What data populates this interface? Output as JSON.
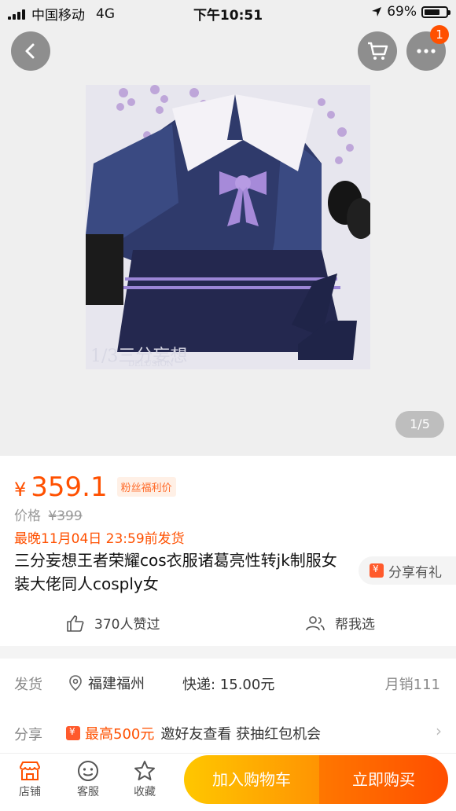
{
  "status_bar": {
    "carrier": "中国移动",
    "network": "4G",
    "time": "下午10:51",
    "battery": "69%"
  },
  "gallery": {
    "counter": "1/5",
    "cart_badge": "1",
    "watermark_main": "1/3三分妄想",
    "watermark_sub": "DELUSION"
  },
  "product": {
    "currency": "¥",
    "price": "359.1",
    "price_tag": "粉丝福利价",
    "orig_label": "价格",
    "orig_price": "¥399",
    "ship_notice": "最晚11月04日 23:59前发货",
    "title": "三分妄想王者荣耀cos衣服诸葛亮性转jk制服女装大佬同人cosply女",
    "share_label": "分享有礼",
    "likes": "370人赞过",
    "help_choose": "帮我选"
  },
  "delivery": {
    "label": "发货",
    "location": "福建福州",
    "fee": "快递: 15.00元",
    "monthly_sales": "月销111"
  },
  "share_row": {
    "label": "分享",
    "max_reward": "最高500元",
    "text": "邀好友查看 获抽红包机会"
  },
  "bottom": {
    "shop": "店铺",
    "service": "客服",
    "favorite": "收藏",
    "add_cart": "加入购物车",
    "buy_now": "立即购买"
  },
  "colors": {
    "accent": "#ff5000",
    "cart_gradient": [
      "#ffc700",
      "#ff9402"
    ],
    "buy_gradient": [
      "#ff7700",
      "#ff4e00"
    ]
  }
}
